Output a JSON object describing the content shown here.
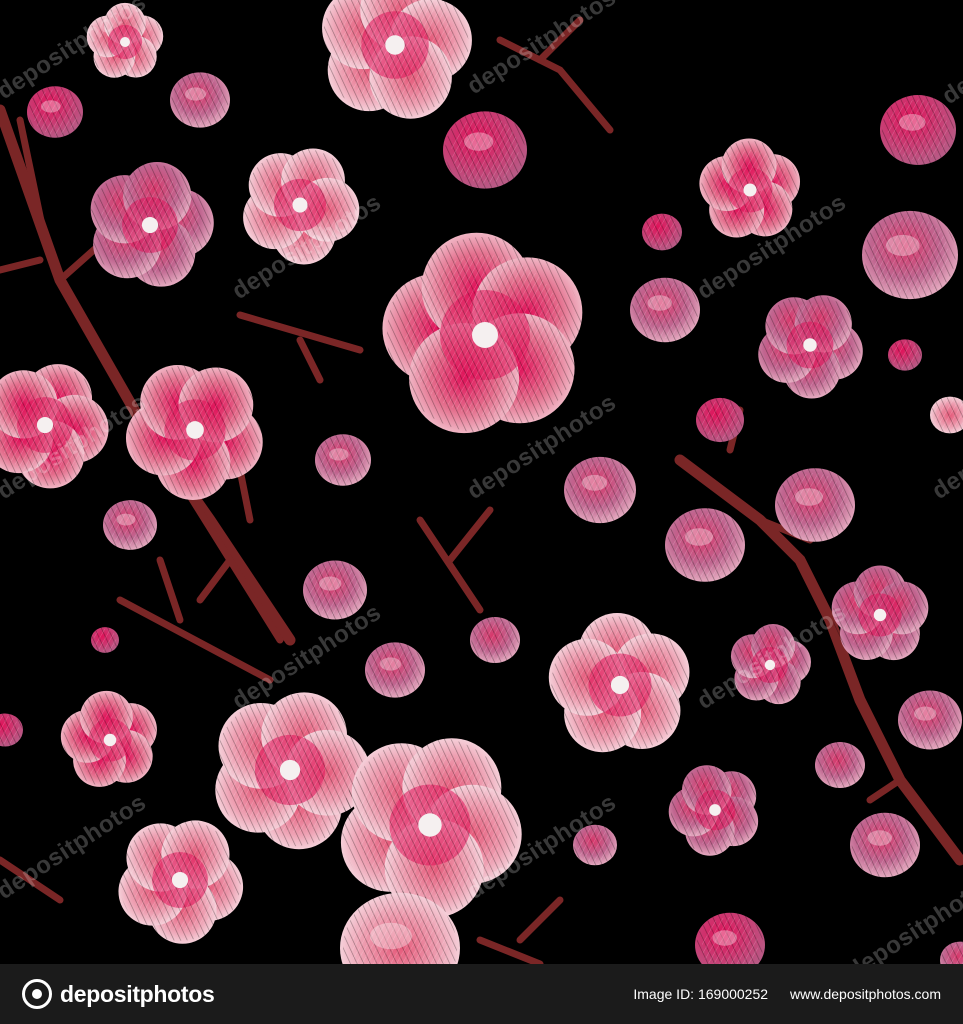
{
  "image": {
    "subject": "embroidered pink cherry blossom pattern",
    "background_color": "#000000",
    "flower_colors": [
      "#e0135a",
      "#f08aa0",
      "#c25a82",
      "#f5d4de"
    ],
    "stem_color": "#7a2626"
  },
  "watermark": {
    "text": "depositphotos"
  },
  "footer": {
    "logo_icon": "depositphotos-logo-icon",
    "logo_text": "depositphotos",
    "image_id": "Image ID: 169000252",
    "url": "www.depositphotos.com"
  }
}
